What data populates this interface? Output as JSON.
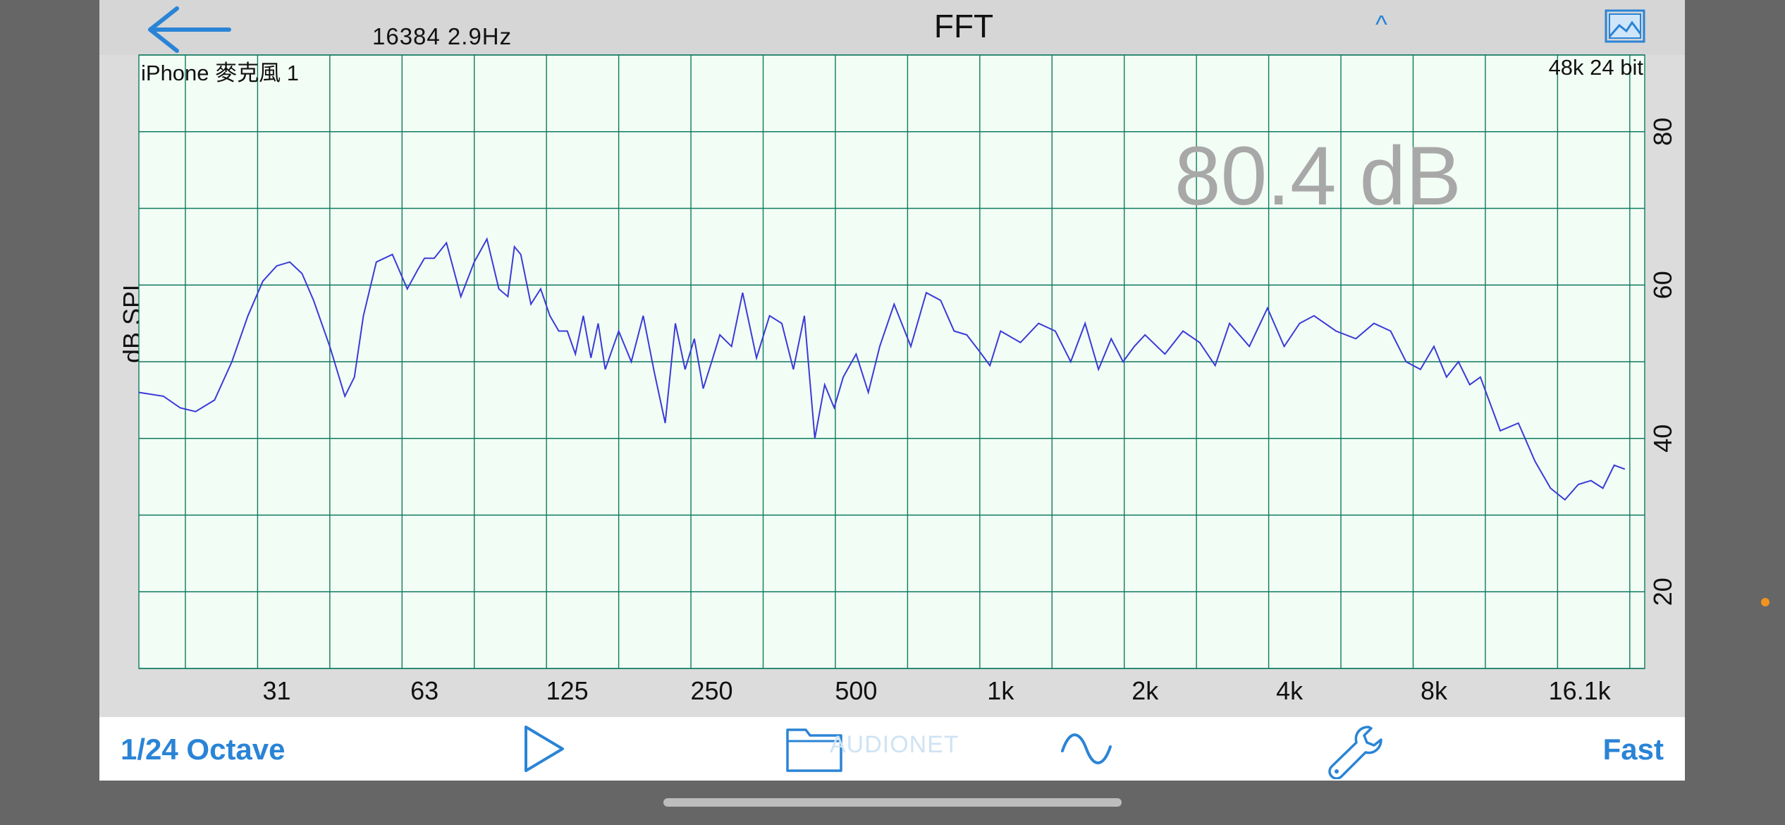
{
  "header": {
    "back_icon": "arrow-left-icon",
    "fft_info": "16384  2.9Hz",
    "title": "FFT",
    "caret": "^",
    "image_icon": "image-icon"
  },
  "plot": {
    "device": "iPhone 麥克風 1",
    "format": "48k 24 bit",
    "level": "80.4 dB",
    "y_axis_label": "dB SPL"
  },
  "toolbar": {
    "octave_label": "1/24 Octave",
    "play_icon": "play-icon",
    "folder_icon": "folder-icon",
    "signal_icon": "sine-wave-icon",
    "settings_icon": "wrench-icon",
    "speed_label": "Fast",
    "watermark": "AUDIONET"
  },
  "colors": {
    "accent": "#2a84d6",
    "grid": "#0f7a5e",
    "trace": "#3a3ad8",
    "plot_bg": "#f2fdf5"
  },
  "chart_data": {
    "type": "line",
    "title": "",
    "xlabel": "",
    "ylabel": "dB SPL",
    "x_scale": "log",
    "x_ticks": [
      "31",
      "63",
      "125",
      "250",
      "500",
      "1k",
      "2k",
      "4k",
      "8k",
      "16.1k"
    ],
    "x_tick_values": [
      31,
      63,
      125,
      250,
      500,
      1000,
      2000,
      4000,
      8000,
      16100
    ],
    "y_ticks": [
      "20",
      "40",
      "60",
      "80"
    ],
    "y_tick_values": [
      20,
      40,
      60,
      80
    ],
    "xlim": [
      16,
      22000
    ],
    "ylim": [
      10,
      90
    ],
    "grid": true,
    "series": [
      {
        "x": [
          16,
          18,
          19.5,
          21,
          23,
          25,
          27,
          29,
          31,
          33,
          35,
          37,
          40,
          43,
          45,
          47,
          50,
          54,
          58,
          61,
          63,
          66,
          70,
          75,
          80,
          85,
          90,
          94,
          97,
          100,
          105,
          110,
          115,
          120,
          125,
          130,
          135,
          140,
          145,
          150,
          160,
          170,
          180,
          190,
          200,
          210,
          220,
          230,
          240,
          250,
          260,
          275,
          290,
          310,
          330,
          350,
          370,
          390,
          410,
          430,
          450,
          470,
          500,
          530,
          560,
          600,
          650,
          700,
          750,
          800,
          850,
          900,
          950,
          1000,
          1100,
          1200,
          1300,
          1400,
          1500,
          1600,
          1700,
          1800,
          1900,
          2000,
          2200,
          2400,
          2600,
          2800,
          3000,
          3300,
          3600,
          3900,
          4200,
          4500,
          5000,
          5500,
          6000,
          6500,
          7000,
          7500,
          8000,
          8500,
          9000,
          9500,
          10000,
          11000,
          12000,
          13000,
          14000,
          15000,
          16000,
          17000,
          18000,
          19000,
          20000
        ],
        "values": [
          46,
          45.5,
          44,
          43.5,
          45,
          50,
          56,
          60.5,
          62.5,
          63,
          61.5,
          58,
          52,
          45.5,
          48,
          56,
          63,
          64,
          59.5,
          62,
          63.5,
          63.5,
          65.5,
          58.5,
          63,
          66,
          59.5,
          58.5,
          65,
          64,
          57.5,
          59.5,
          56,
          54,
          54,
          51,
          56,
          50.5,
          55,
          49,
          54,
          50,
          56,
          48.5,
          42,
          55,
          49,
          53,
          46.5,
          50,
          53.5,
          52,
          59,
          50.5,
          56,
          55,
          49,
          56,
          40,
          47,
          44,
          48,
          51,
          46,
          52,
          57.5,
          52,
          59,
          58,
          54,
          53.5,
          51.5,
          49.5,
          54,
          52.5,
          55,
          54,
          50,
          55,
          49,
          53,
          50,
          52,
          53.5,
          51,
          54,
          52.5,
          49.5,
          55,
          52,
          57,
          52,
          55,
          56,
          54,
          53,
          55,
          54,
          50,
          49,
          52,
          48,
          50,
          47,
          48,
          41,
          42,
          37,
          33.5,
          32,
          34,
          34.5,
          33.5,
          36.5,
          36
        ]
      }
    ]
  }
}
